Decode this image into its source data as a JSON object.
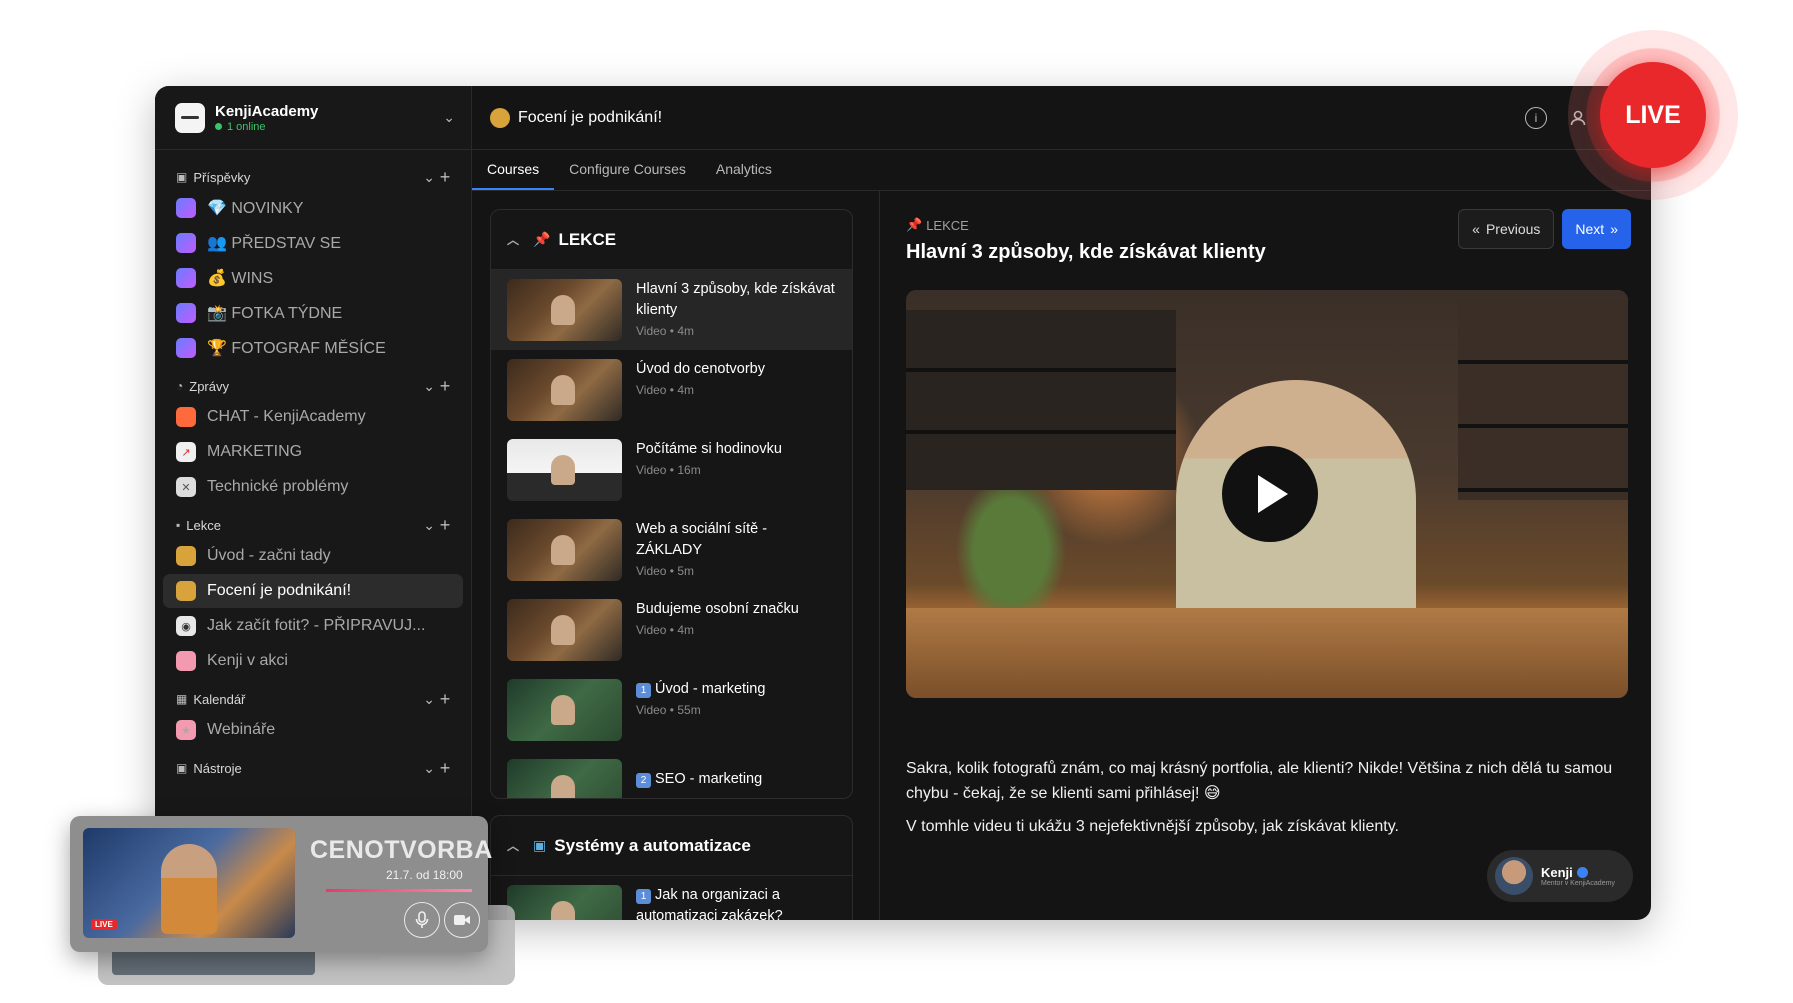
{
  "workspace": {
    "name": "KenjiAcademy",
    "online": "1 online"
  },
  "sidebar": {
    "sections": [
      {
        "label": "Příspěvky",
        "items": [
          {
            "label": "💎 NOVINKY"
          },
          {
            "label": "👥 PŘEDSTAV SE"
          },
          {
            "label": "💰 WINS"
          },
          {
            "label": "📸 FOTKA TÝDNE"
          },
          {
            "label": "🏆 FOTOGRAF MĚSÍCE"
          }
        ]
      },
      {
        "label": "Zprávy",
        "items": [
          {
            "label": "CHAT - KenjiAcademy"
          },
          {
            "label": "MARKETING"
          },
          {
            "label": "Technické problémy"
          }
        ]
      },
      {
        "label": "Lekce",
        "items": [
          {
            "label": "Úvod - začni tady"
          },
          {
            "label": "Focení je podnikání!"
          },
          {
            "label": "Jak začít fotit? - PŘIPRAVUJ..."
          },
          {
            "label": "Kenji v akci"
          }
        ]
      },
      {
        "label": "Kalendář",
        "items": [
          {
            "label": "Webináře"
          }
        ]
      },
      {
        "label": "Nástroje",
        "items": []
      }
    ]
  },
  "topbar": {
    "title": "Focení je podnikání!"
  },
  "tabs": [
    {
      "label": "Courses"
    },
    {
      "label": "Configure Courses"
    },
    {
      "label": "Analytics"
    }
  ],
  "lessons_card": {
    "title": "LEKCE",
    "lessons": [
      {
        "title": "Hlavní 3 způsoby, kde získávat klienty",
        "meta": "Video • 4m"
      },
      {
        "title": "Úvod do cenotvorby",
        "meta": "Video • 4m"
      },
      {
        "title": "Počítáme si hodinovku",
        "meta": "Video • 16m"
      },
      {
        "title": "Web a sociální sítě - ZÁKLADY",
        "meta": "Video • 5m"
      },
      {
        "title": "Budujeme osobní značku",
        "meta": "Video • 4m"
      },
      {
        "title": "Úvod - marketing",
        "meta": "Video • 55m"
      },
      {
        "title": "SEO - marketing",
        "meta": ""
      }
    ]
  },
  "systems_card": {
    "title": "Systémy a automatizace",
    "lessons": [
      {
        "title": "Jak na organizaci a automatizaci zakázek?"
      }
    ]
  },
  "detail": {
    "crumb": "LEKCE",
    "title": "Hlavní 3 způsoby, kde získávat klienty",
    "prev": "Previous",
    "next": "Next",
    "desc1": "Sakra, kolik fotografů znám, co maj krásný portfolia, ale klienti? Nikde! Většina z nich dělá tu samou chybu - čekaj, že se klienti sami přihlásej! 😅",
    "desc2": "V tomhle videu ti ukážu 3 nejefektivnější způsoby, jak získávat klienty.",
    "author": "Kenji",
    "author_sub": "Mentor v KenjiAcademy"
  },
  "live_badge": "LIVE",
  "pip": {
    "title": "CENOTVORBA",
    "date": "21.7. od 18:00",
    "live": "LIVE"
  },
  "colors": {
    "accent": "#2563eb",
    "live": "#e8282b",
    "online": "#3cc46b"
  }
}
